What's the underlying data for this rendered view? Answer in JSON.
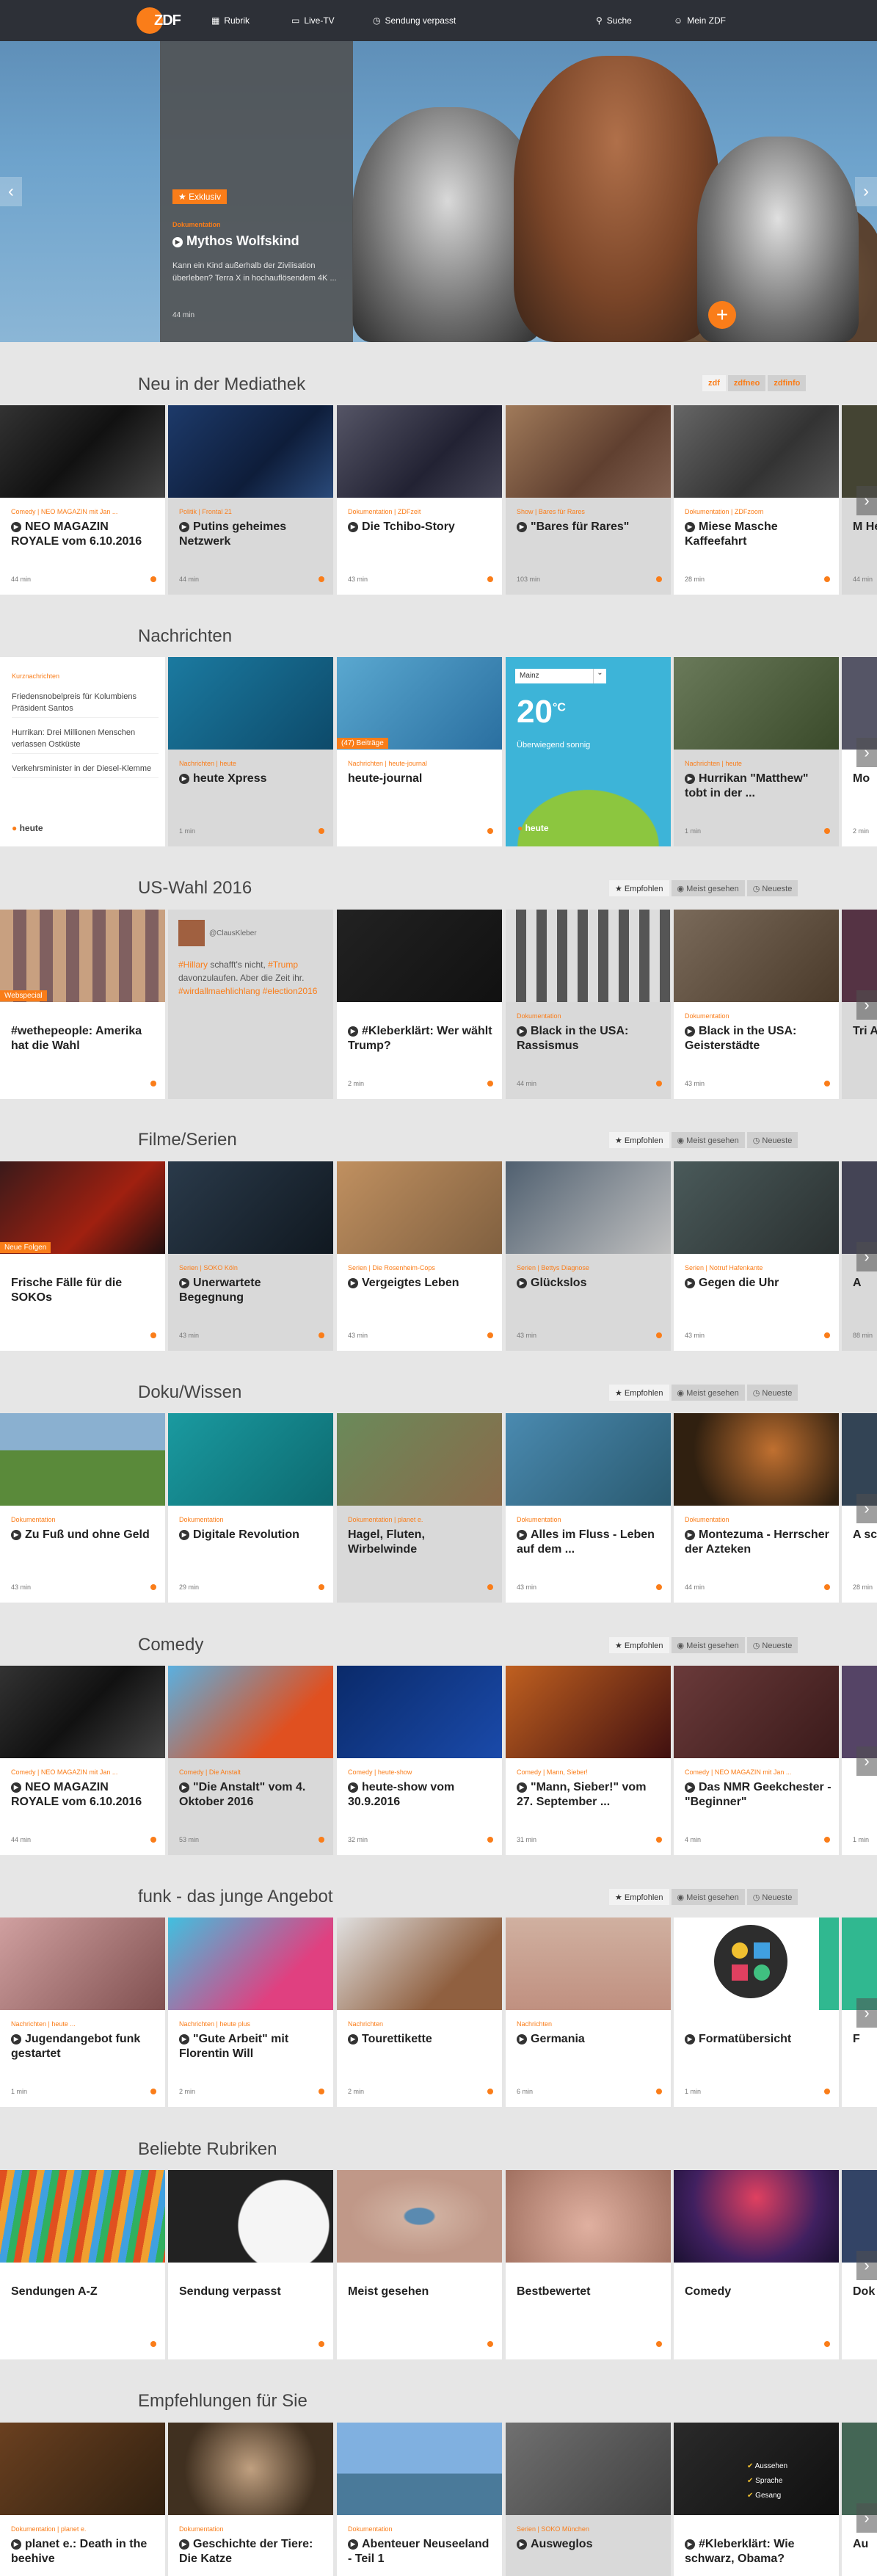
{
  "header": {
    "logo_text": "ZDF",
    "nav": [
      {
        "icon": "grid-icon",
        "glyph": "▦",
        "label": "Rubrik"
      },
      {
        "icon": "tv-icon",
        "glyph": "▭",
        "label": "Live-TV"
      },
      {
        "icon": "clock-icon",
        "glyph": "◷",
        "label": "Sendung verpasst"
      },
      {
        "icon": "search-icon",
        "glyph": "⚲",
        "label": "Suche"
      },
      {
        "icon": "user-icon",
        "glyph": "☺",
        "label": "Mein ZDF"
      }
    ]
  },
  "hero": {
    "badge": "★ Exklusiv",
    "category": "Dokumentation",
    "title": "Mythos Wolfskind",
    "description": "Kann ein Kind außerhalb der Zivilisation überleben? Terra X in hochauflösendem 4K ...",
    "duration": "44 min"
  },
  "sections": {
    "neu": {
      "title": "Neu in der Mediathek",
      "chips": [
        "zdf",
        "zdfneo",
        "zdfinfo"
      ],
      "tiles": [
        {
          "cat": "Comedy | NEO MAGAZIN mit Jan ...",
          "title": "NEO MAGAZIN ROYALE vom 6.10.2016",
          "dur": "44 min"
        },
        {
          "cat": "Politik | Frontal 21",
          "title": "Putins geheimes Netzwerk",
          "dur": "44 min"
        },
        {
          "cat": "Dokumentation | ZDFzeit",
          "title": "Die Tchibo-Story",
          "dur": "43 min"
        },
        {
          "cat": "Show | Bares für Rares",
          "title": "\"Bares für Rares\"",
          "dur": "103 min"
        },
        {
          "cat": "Dokumentation | ZDFzoom",
          "title": "Miese Masche Kaffeefahrt",
          "dur": "28 min"
        },
        {
          "cat": "",
          "title": "M Her",
          "dur": "44 min"
        }
      ]
    },
    "nachrichten": {
      "title": "Nachrichten",
      "list_head": "Kurznachrichten",
      "list": [
        "Friedensnobelpreis für Kolumbiens Präsident Santos",
        "Hurrikan: Drei Millionen Menschen verlassen Ostküste",
        "Verkehrsminister in der Diesel-Klemme"
      ],
      "logo": "heute",
      "tiles": [
        {
          "cat": "Nachrichten | heute",
          "title": "heute Xpress",
          "dur": "1 min"
        },
        {
          "cat": "Nachrichten | heute-journal",
          "title": "heute-journal",
          "tag": "(47) Beiträge"
        },
        {
          "cat": "Nachrichten | heute",
          "title": "Hurrikan \"Matthew\" tobt in der ...",
          "dur": "1 min"
        },
        {
          "cat": "",
          "title": "Mo",
          "dur": "2 min"
        }
      ],
      "weather": {
        "city": "Mainz",
        "temp": "20",
        "unit": "°C",
        "cond": "Überwiegend sonnig",
        "logo": "heute"
      }
    },
    "uswahl": {
      "title": "US-Wahl 2016",
      "chips": [
        "★ Empfohlen",
        "◉ Meist gesehen",
        "◷ Neueste"
      ],
      "tiles": [
        {
          "tag": "Webspecial",
          "title": "#wethepeople: Amerika hat die Wahl"
        },
        {
          "title": "#Kleberklärt: Wer wählt Trump?",
          "dur": "2 min"
        },
        {
          "cat": "Dokumentation",
          "title": "Black in the USA: Rassismus",
          "dur": "44 min"
        },
        {
          "cat": "Dokumentation",
          "title": "Black in the USA: Geisterstädte",
          "dur": "43 min"
        },
        {
          "title": "Tri Abe"
        }
      ],
      "tweet": {
        "user": "@ClausKleber",
        "text_pre": "#Hillary",
        "text_mid": " schafft's nicht, ",
        "text_tr": "#Trump",
        "text_post": " davonzulaufen. Aber die Zeit ihr.",
        "tags": "#wirdallmaehlichlang #election2016"
      }
    },
    "filme": {
      "title": "Filme/Serien",
      "chips": [
        "★ Empfohlen",
        "◉ Meist gesehen",
        "◷ Neueste"
      ],
      "tiles": [
        {
          "tag": "Neue Folgen",
          "title": "Frische Fälle für die SOKOs"
        },
        {
          "cat": "Serien | SOKO Köln",
          "title": "Unerwartete Begegnung",
          "dur": "43 min"
        },
        {
          "cat": "Serien | Die Rosenheim-Cops",
          "title": "Vergeigtes Leben",
          "dur": "43 min"
        },
        {
          "cat": "Serien | Bettys Diagnose",
          "title": "Glückslos",
          "dur": "43 min"
        },
        {
          "cat": "Serien | Notruf Hafenkante",
          "title": "Gegen die Uhr",
          "dur": "43 min"
        },
        {
          "title": "A",
          "dur": "88 min"
        }
      ]
    },
    "doku": {
      "title": "Doku/Wissen",
      "chips": [
        "★ Empfohlen",
        "◉ Meist gesehen",
        "◷ Neueste"
      ],
      "tiles": [
        {
          "cat": "Dokumentation",
          "title": "Zu Fuß und ohne Geld",
          "dur": "43 min"
        },
        {
          "cat": "Dokumentation",
          "title": "Digitale Revolution",
          "dur": "29 min"
        },
        {
          "cat": "Dokumentation | planet e.",
          "title": "Hagel, Fluten, Wirbelwinde",
          "dur": ""
        },
        {
          "cat": "Dokumentation",
          "title": "Alles im Fluss - Leben auf dem ...",
          "dur": "43 min"
        },
        {
          "cat": "Dokumentation",
          "title": "Montezuma - Herrscher der Azteken",
          "dur": "44 min"
        },
        {
          "title": "A sch",
          "dur": "28 min"
        }
      ]
    },
    "comedy": {
      "title": "Comedy",
      "chips": [
        "★ Empfohlen",
        "◉ Meist gesehen",
        "◷ Neueste"
      ],
      "tiles": [
        {
          "cat": "Comedy | NEO MAGAZIN mit Jan ...",
          "title": "NEO MAGAZIN ROYALE vom 6.10.2016",
          "dur": "44 min"
        },
        {
          "cat": "Comedy | Die Anstalt",
          "title": "\"Die Anstalt\" vom 4. Oktober 2016",
          "dur": "53 min"
        },
        {
          "cat": "Comedy | heute-show",
          "title": "heute-show vom 30.9.2016",
          "dur": "32 min"
        },
        {
          "cat": "Comedy | Mann, Sieber!",
          "title": "\"Mann, Sieber!\" vom 27. September ...",
          "dur": "31 min"
        },
        {
          "cat": "Comedy | NEO MAGAZIN mit Jan ...",
          "title": "Das NMR Geekchester - \"Beginner\"",
          "dur": "4 min"
        },
        {
          "title": "",
          "dur": "1 min"
        }
      ]
    },
    "funk": {
      "title": "funk - das junge Angebot",
      "chips": [
        "★ Empfohlen",
        "◉ Meist gesehen",
        "◷ Neueste"
      ],
      "tiles": [
        {
          "cat": "Nachrichten | heute ...",
          "title": "Jugendangebot funk gestartet",
          "dur": "1 min"
        },
        {
          "cat": "Nachrichten | heute plus",
          "title": "\"Gute Arbeit\" mit Florentin Will",
          "dur": "2 min"
        },
        {
          "cat": "Nachrichten",
          "title": "Tourettikette",
          "dur": "2 min"
        },
        {
          "cat": "Nachrichten",
          "title": "Germania",
          "dur": "6 min"
        },
        {
          "title": "Formatübersicht",
          "dur": "1 min"
        },
        {
          "title": "F",
          "dur": ""
        }
      ]
    },
    "rubriken": {
      "title": "Beliebte Rubriken",
      "tiles": [
        {
          "title": "Sendungen A-Z"
        },
        {
          "title": "Sendung verpasst"
        },
        {
          "title": "Meist gesehen"
        },
        {
          "title": "Bestbewertet"
        },
        {
          "title": "Comedy"
        },
        {
          "title": "Dok"
        }
      ]
    },
    "empf": {
      "title": "Empfehlungen für Sie",
      "tiles": [
        {
          "cat": "Dokumentation | planet e.",
          "title": "planet e.: Death in the beehive"
        },
        {
          "cat": "Dokumentation",
          "title": "Geschichte der Tiere: Die Katze"
        },
        {
          "cat": "Dokumentation",
          "title": "Abenteuer Neuseeland - Teil 1"
        },
        {
          "cat": "Serien | SOKO München",
          "title": "Ausweglos"
        },
        {
          "title": "#Kleberklärt: Wie schwarz, Obama?"
        },
        {
          "title": "Au"
        }
      ],
      "checklist": [
        "Aussehen",
        "Sprache",
        "Gesang"
      ]
    }
  },
  "colors": {
    "accent": "#fa7d19",
    "header": "#2d3037"
  }
}
